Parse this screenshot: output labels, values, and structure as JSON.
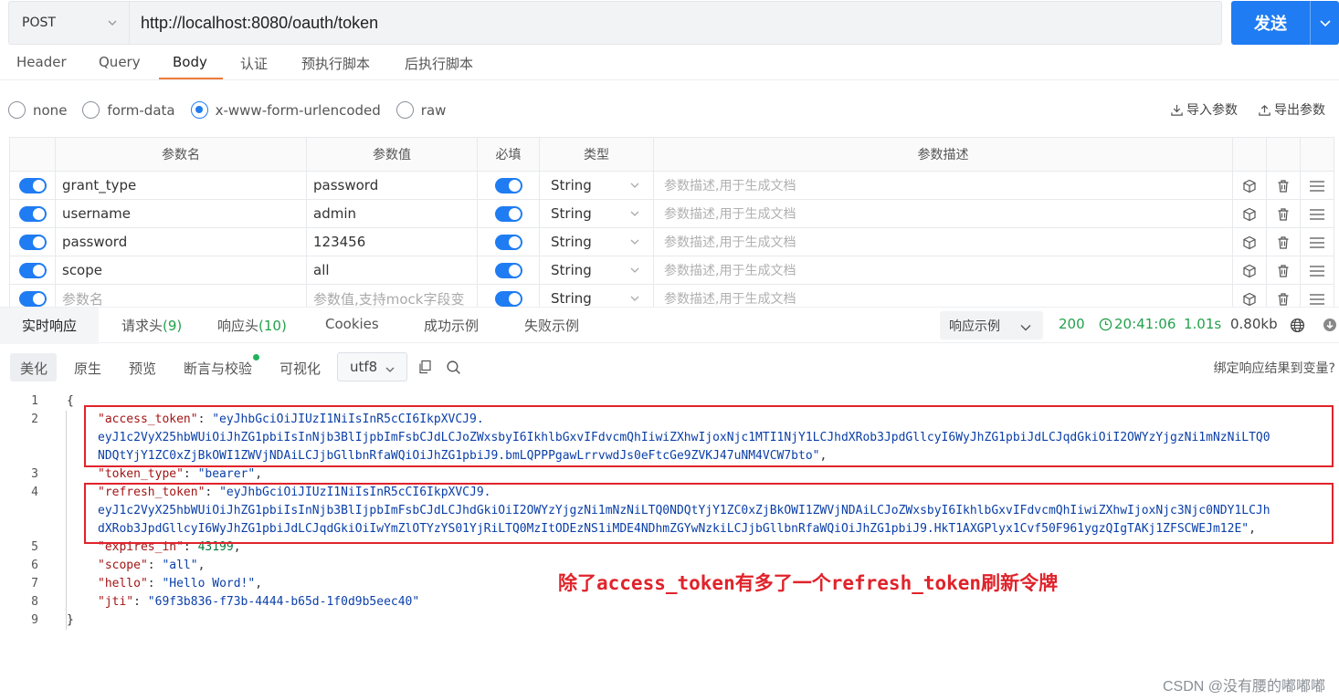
{
  "request": {
    "method": "POST",
    "url": "http://localhost:8080/oauth/token",
    "send_label": "发送"
  },
  "request_tabs": [
    "Header",
    "Query",
    "Body",
    "认证",
    "预执行脚本",
    "后执行脚本"
  ],
  "active_request_tab": "Body",
  "body_types": [
    "none",
    "form-data",
    "x-www-form-urlencoded",
    "raw"
  ],
  "selected_body_type": "x-www-form-urlencoded",
  "import_label": "导入参数",
  "export_label": "导出参数",
  "params_table": {
    "headers": {
      "name": "参数名",
      "value": "参数值",
      "required": "必填",
      "type": "类型",
      "description": "参数描述"
    },
    "rows": [
      {
        "enabled": true,
        "name": "grant_type",
        "value": "password",
        "required": true,
        "type": "String",
        "description": "参数描述,用于生成文档"
      },
      {
        "enabled": true,
        "name": "username",
        "value": "admin",
        "required": true,
        "type": "String",
        "description": "参数描述,用于生成文档"
      },
      {
        "enabled": true,
        "name": "password",
        "value": "123456",
        "required": true,
        "type": "String",
        "description": "参数描述,用于生成文档"
      },
      {
        "enabled": true,
        "name": "scope",
        "value": "all",
        "required": true,
        "type": "String",
        "description": "参数描述,用于生成文档"
      }
    ],
    "placeholder_row": {
      "name": "参数名",
      "value": "参数值,支持mock字段变",
      "type": "String",
      "description": "参数描述,用于生成文档"
    }
  },
  "response_tabs": {
    "realtime": "实时响应",
    "req_headers": "请求头",
    "req_headers_count": "(9)",
    "resp_headers": "响应头",
    "resp_headers_count": "(10)",
    "cookies": "Cookies",
    "success_example": "成功示例",
    "fail_example": "失败示例"
  },
  "response_example_select": "响应示例",
  "response_status": {
    "code": "200",
    "time": "20:41:06",
    "duration": "1.01s",
    "size": "0.80kb"
  },
  "viewer_tabs": [
    "美化",
    "原生",
    "预览",
    "断言与校验",
    "可视化"
  ],
  "active_viewer_tab": "美化",
  "encoding": "utf8",
  "bind_variable_label": "绑定响应结果到变量?",
  "code_lines": {
    "l1": "{",
    "access_key": "\"access_token\"",
    "access_v1": "\"eyJhbGciOiJIUzI1NiIsInR5cCI6IkpXVCJ9.",
    "access_v2": "eyJ1c2VyX25hbWUiOiJhZG1pbiIsInNjb3BlIjpbImFsbCJdLCJoZWxsbyI6IkhlbGxvIFdvcmQhIiwiZXhwIjoxNjc1MTI1NjY1LCJhdXRob3JpdGllcyI6WyJhZG1pbiJdLCJqdGkiOiI2OWYzYjgzNi1mNzNiLTQ0",
    "access_v3": "NDQtYjY1ZC0xZjBkOWI1ZWVjNDAiLCJjbGllbnRfaWQiOiJhZG1pbiJ9.bmLQPPPgawLrrvwdJs0eFtcGe9ZVKJ47uNM4VCW7bto\"",
    "token_type_key": "\"token_type\"",
    "token_type_val": "\"bearer\"",
    "refresh_key": "\"refresh_token\"",
    "refresh_v1": "\"eyJhbGciOiJIUzI1NiIsInR5cCI6IkpXVCJ9.",
    "refresh_v2": "eyJ1c2VyX25hbWUiOiJhZG1pbiIsInNjb3BlIjpbImFsbCJdLCJhdGkiOiI2OWYzYjgzNi1mNzNiLTQ0NDQtYjY1ZC0xZjBkOWI1ZWVjNDAiLCJoZWxsbyI6IkhlbGxvIFdvcmQhIiwiZXhwIjoxNjc3Njc0NDY1LCJh",
    "refresh_v3": "dXRob3JpdGllcyI6WyJhZG1pbiJdLCJqdGkiOiIwYmZlOTYzYS01YjRiLTQ0MzItODEzNS1iMDE4NDhmZGYwNzkiLCJjbGllbnRfaWQiOiJhZG1pbiJ9.HkT1AXGPlyx1Cvf50F961ygzQIgTAKj1ZFSCWEJm12E\"",
    "expires_key": "\"expires_in\"",
    "expires_val": "43199",
    "scope_key": "\"scope\"",
    "scope_val": "\"all\"",
    "hello_key": "\"hello\"",
    "hello_val": "\"Hello Word!\"",
    "jti_key": "\"jti\"",
    "jti_val": "\"69f3b836-f73b-4444-b65d-1f0d9b5eec40\"",
    "l9": "}"
  },
  "line_numbers": [
    "1",
    "2",
    "3",
    "4",
    "5",
    "6",
    "7",
    "8",
    "9"
  ],
  "annotation_text": "除了access_token有多了一个refresh_token刷新令牌",
  "watermark": "CSDN @没有腰的嘟嘟嘟",
  "colors": {
    "accent": "#1f7cf2",
    "success": "#23a14b",
    "active_tab_underline": "#f07a3a",
    "annotation": "#e0232b"
  }
}
